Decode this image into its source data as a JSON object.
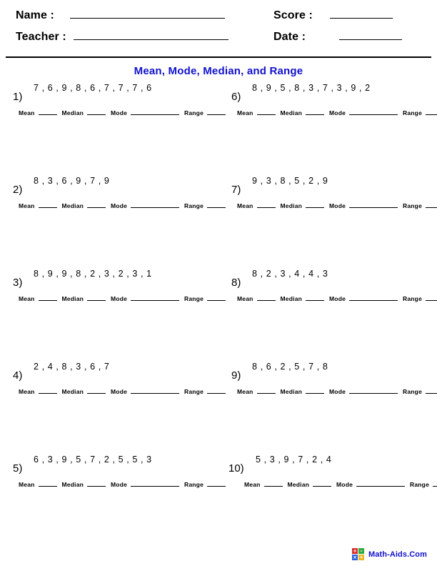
{
  "header": {
    "name_label": "Name :",
    "teacher_label": "Teacher :",
    "score_label": "Score :",
    "date_label": "Date :"
  },
  "title": "Mean, Mode, Median, and Range",
  "answer_labels": {
    "mean": "Mean",
    "median": "Median",
    "mode": "Mode",
    "range": "Range"
  },
  "problems": [
    {
      "number": "1)",
      "sequence": "7 , 6 , 9 , 8 , 6 , 7 , 7 , 7 , 6"
    },
    {
      "number": "2)",
      "sequence": "8 , 3 , 6 , 9 , 7 , 9"
    },
    {
      "number": "3)",
      "sequence": "8 , 9 , 9 , 8 , 2 , 3 , 2 , 3 , 1"
    },
    {
      "number": "4)",
      "sequence": "2 , 4 , 8 , 3 , 6 , 7"
    },
    {
      "number": "5)",
      "sequence": "6 , 3 , 9 , 5 , 7 , 2 , 5 , 5 , 3"
    },
    {
      "number": "6)",
      "sequence": "8 , 9 , 5 , 8 , 3 , 7 , 3 , 9 , 2"
    },
    {
      "number": "7)",
      "sequence": "9 , 3 , 8 , 5 , 2 , 9"
    },
    {
      "number": "8)",
      "sequence": "8 , 2 , 3 , 4 , 4 , 3"
    },
    {
      "number": "9)",
      "sequence": "8 , 6 , 2 , 5 , 7 , 8"
    },
    {
      "number": "10)",
      "sequence": "5 , 3 , 9 , 7 , 2 , 4"
    }
  ],
  "footer": {
    "brand": "Math-Aids.Com",
    "logo_symbols": [
      "+",
      "–",
      "×",
      "÷"
    ],
    "logo_colors": [
      "#d92b2b",
      "#2faa3f",
      "#2b5fd9",
      "#e8b622"
    ],
    "brand_color": "#1111cc"
  }
}
